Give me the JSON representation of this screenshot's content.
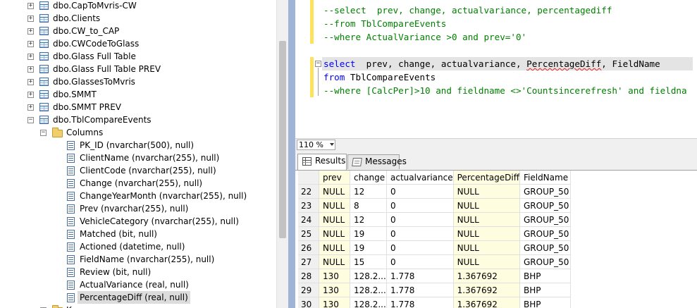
{
  "explorer": {
    "tables": [
      {
        "name": "dbo.CapToMvris-CW",
        "expander": "+"
      },
      {
        "name": "dbo.Clients",
        "expander": "+"
      },
      {
        "name": "dbo.CW_to_CAP",
        "expander": "+"
      },
      {
        "name": "dbo.CWCodeToGlass",
        "expander": "+"
      },
      {
        "name": "dbo.Glass Full Table",
        "expander": "+"
      },
      {
        "name": "dbo.Glass Full Table PREV",
        "expander": "+"
      },
      {
        "name": "dbo.GlassesToMvris",
        "expander": "+"
      },
      {
        "name": "dbo.SMMT",
        "expander": "+"
      },
      {
        "name": "dbo.SMMT PREV",
        "expander": "+"
      },
      {
        "name": "dbo.TblCompareEvents",
        "expander": "−"
      }
    ],
    "columns_folder": {
      "name": "Columns",
      "expander": "−"
    },
    "columns": [
      "PK_ID (nvarchar(500), null)",
      "ClientName (nvarchar(255), null)",
      "ClientCode (nvarchar(255), null)",
      "Change (nvarchar(255), null)",
      "ChangeYearMonth (nvarchar(255), null)",
      "Prev (nvarchar(255), null)",
      "VehicleCategory (nvarchar(255), null)",
      "Matched (bit, null)",
      "Actioned (datetime, null)",
      "FieldName (nvarchar(255), null)",
      "Review (bit, null)",
      "ActualVariance (real, null)",
      "PercentageDiff (real, null)"
    ],
    "partial_last": "K"
  },
  "editor": {
    "comment_block": [
      "--select  prev, change, actualvariance, percentagediff",
      "--from TblCompareEvents",
      "--where ActualVariance >0 and prev='0'"
    ],
    "query": {
      "select_kw": "select",
      "select_cols_a": "  prev, change, actualvariance, ",
      "select_squiggle": "PercentageDiff",
      "select_cols_b": ", FieldName",
      "from_kw": "from",
      "from_table": " TblCompareEvents",
      "where_comment": "--where [CalcPer]>10 and fieldname <>'Countsincerefresh' and fieldna"
    }
  },
  "zoom": {
    "value": "110 %"
  },
  "results": {
    "tabs": [
      {
        "label": "Results",
        "icon": "grid-icon"
      },
      {
        "label": "Messages",
        "icon": "messages-icon"
      }
    ],
    "columns": [
      "prev",
      "change",
      "actualvariance",
      "PercentageDiff",
      "FieldName"
    ],
    "rows": [
      [
        "22",
        "NULL",
        "12",
        "0",
        "NULL",
        "GROUP_50"
      ],
      [
        "23",
        "NULL",
        "8",
        "0",
        "NULL",
        "GROUP_50"
      ],
      [
        "24",
        "NULL",
        "12",
        "0",
        "NULL",
        "GROUP_50"
      ],
      [
        "25",
        "NULL",
        "19",
        "0",
        "NULL",
        "GROUP_50"
      ],
      [
        "26",
        "NULL",
        "19",
        "0",
        "NULL",
        "GROUP_50"
      ],
      [
        "27",
        "NULL",
        "15",
        "0",
        "NULL",
        "GROUP_50"
      ],
      [
        "28",
        "130",
        "128.2...",
        "1.778",
        "1.367692",
        "BHP"
      ],
      [
        "29",
        "130",
        "128.2...",
        "1.778",
        "1.367692",
        "BHP"
      ],
      [
        "30",
        "130",
        "128.2...",
        "1.778",
        "1.367692",
        "BHP"
      ]
    ]
  },
  "colors": {
    "comment": "#008000",
    "keyword": "#0000ff",
    "change_bar": "#ffe25c",
    "splitter": "#9fb4d6",
    "highlight_col": "#fffde0"
  }
}
